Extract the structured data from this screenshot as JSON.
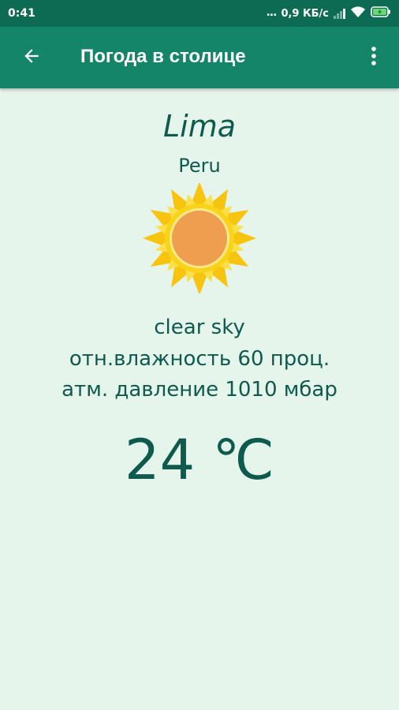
{
  "status_bar": {
    "time": "0:41",
    "dots": "...",
    "speed": "0,9 КБ/с",
    "icons": [
      "signal-icon",
      "wifi-icon",
      "battery-charging-icon"
    ]
  },
  "app_bar": {
    "title": "Погода в столице",
    "back_icon": "arrow-left-icon",
    "menu_icon": "more-vert-icon",
    "color": "#15856a"
  },
  "weather": {
    "city": "Lima",
    "country": "Peru",
    "icon": "sun-icon",
    "description": "clear sky",
    "humidity": "отн.влажность 60 проц.",
    "pressure": "атм. давление 1010 мбар",
    "temperature": "24 ℃"
  },
  "colors": {
    "background": "#e6f5ec",
    "text": "#0e5a4c",
    "status_bar": "#0d6b53"
  }
}
